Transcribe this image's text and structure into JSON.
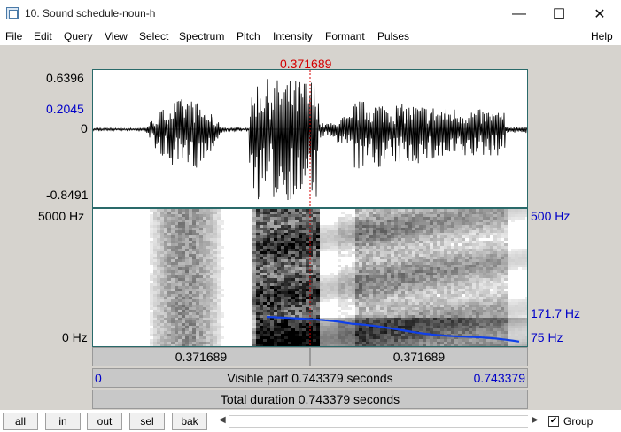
{
  "window": {
    "title": "10. Sound schedule-noun-h",
    "minimize": "—",
    "maximize": "☐",
    "close": "✕"
  },
  "menu": [
    "File",
    "Edit",
    "Query",
    "View",
    "Select",
    "Spectrum",
    "Pitch",
    "Intensity",
    "Formant",
    "Pulses",
    "Help"
  ],
  "cursor_time": "0.371689",
  "waveform": {
    "y_max": "0.6396",
    "y_cursor": "0.2045",
    "y_zero": "0",
    "y_min": "-0.8491"
  },
  "spectrogram": {
    "freq_max": "5000 Hz",
    "freq_min": "0 Hz",
    "pitch_max": "500 Hz",
    "pitch_cursor": "171.7 Hz",
    "pitch_min": "75 Hz"
  },
  "bars": {
    "left_segment": "0.371689",
    "right_segment": "0.371689",
    "visible_start": "0",
    "visible_part": "Visible part 0.743379 seconds",
    "visible_end": "0.743379",
    "total_duration": "Total duration 0.743379 seconds"
  },
  "toolbar": {
    "buttons": [
      "all",
      "in",
      "out",
      "sel",
      "bak"
    ],
    "group_label": "Group",
    "group_checked": "✔"
  },
  "colors": {
    "pitch": "#1040e8",
    "cursor": "#d40000"
  }
}
